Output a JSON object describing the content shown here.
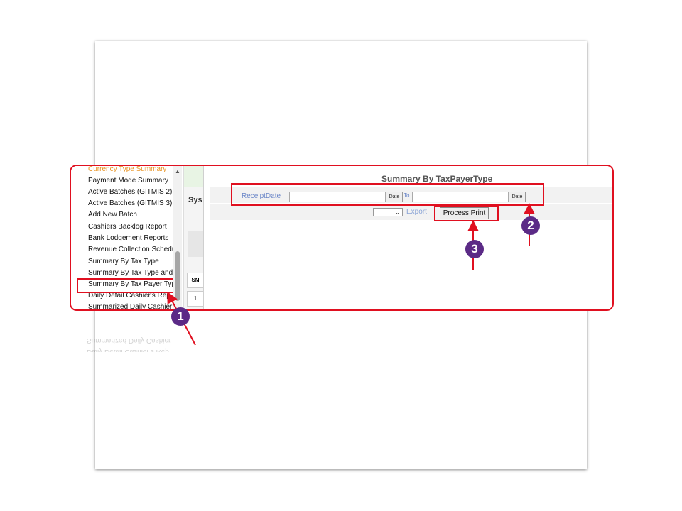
{
  "menu": {
    "items": [
      {
        "label": "Currency Type Summary"
      },
      {
        "label": "Payment Mode Summary"
      },
      {
        "label": "Active Batches (GITMIS 2)"
      },
      {
        "label": "Active Batches (GITMIS 3)"
      },
      {
        "label": "Add New Batch"
      },
      {
        "label": "Cashiers Backlog Report"
      },
      {
        "label": "Bank Lodgement Reports"
      },
      {
        "label": "Revenue Collection Schedu"
      },
      {
        "label": "Summary By Tax Type"
      },
      {
        "label": "Summary By Tax Type and"
      },
      {
        "label": "Summary By Tax Payer Typ"
      },
      {
        "label": "Daily Detail Cashier's Rep"
      },
      {
        "label": "Summarized Daily Cashier"
      }
    ]
  },
  "midcol": {
    "title": "Sys",
    "sn_header": "SN",
    "row1": "1"
  },
  "main": {
    "title": "Summary By TaxPayerType",
    "receipt_label": "ReceiptDate",
    "from_value": "",
    "date_button": "Date",
    "to_label": "To",
    "to_value": "",
    "select_value": "",
    "export_label": "Export",
    "process_print": "Process Print"
  },
  "callouts": {
    "one": "1",
    "two": "2",
    "three": "3"
  },
  "colors": {
    "highlight": "#e01020",
    "badge": "#5b2a86",
    "link": "#6a86c8"
  }
}
